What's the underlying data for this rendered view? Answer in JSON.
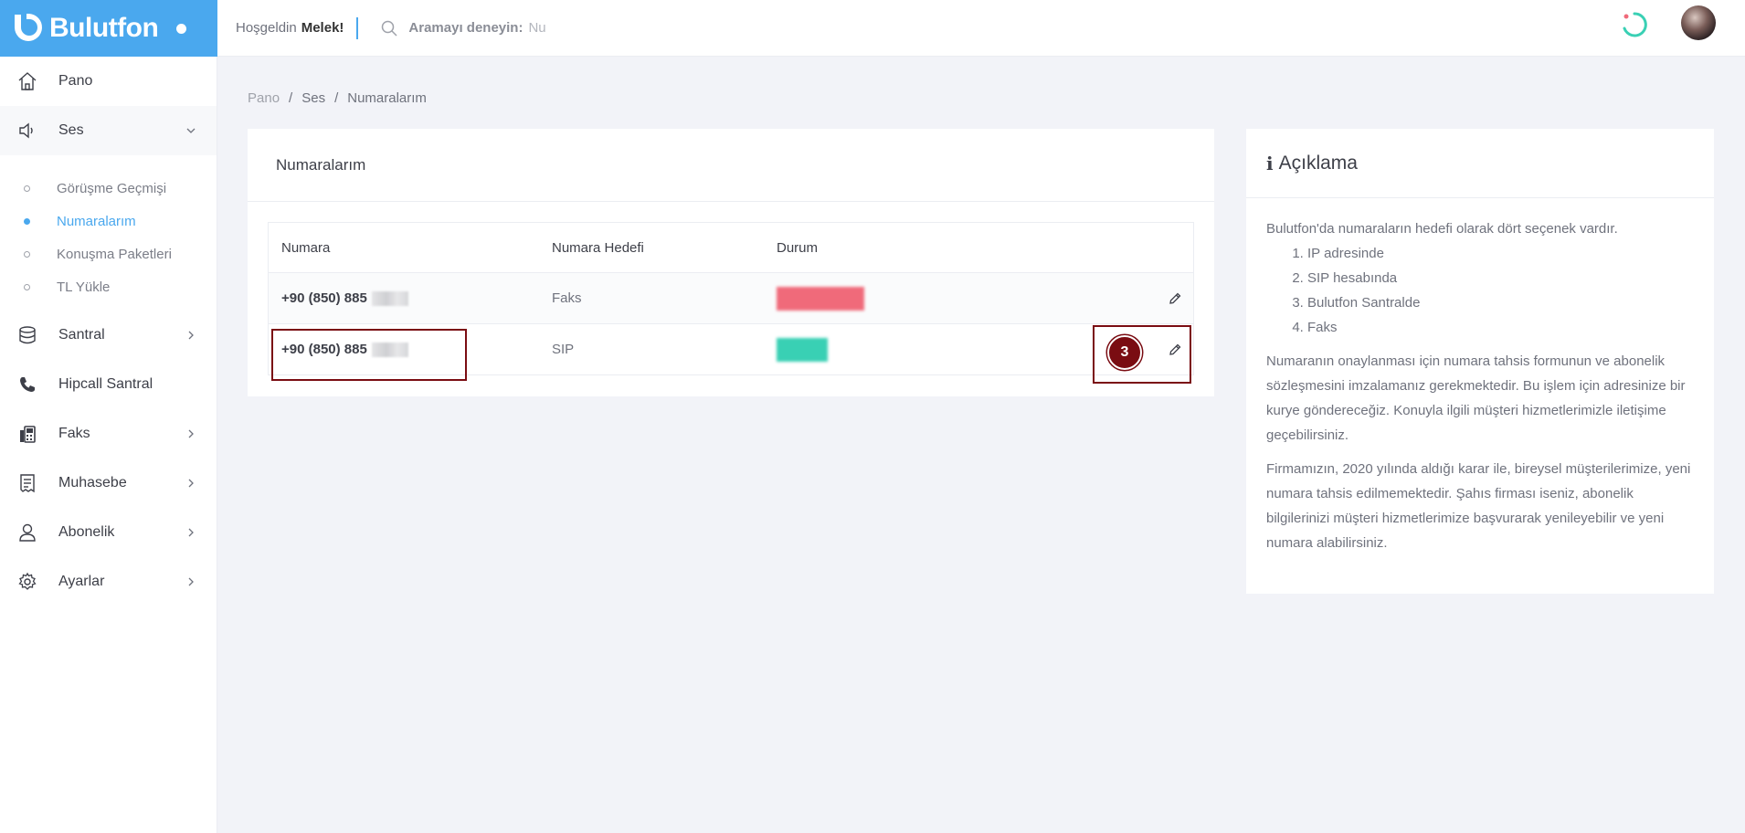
{
  "brand": {
    "name": "Bulutfon"
  },
  "header": {
    "welcome_prefix": "Hoşgeldin",
    "user_name": "Melek!",
    "search_label": "Aramayı deneyin:",
    "search_value": "Nu"
  },
  "sidebar": {
    "items": [
      {
        "label": "Pano",
        "icon": "home-icon"
      },
      {
        "label": "Ses",
        "icon": "speaker-icon"
      },
      {
        "label": "Santral",
        "icon": "database-icon"
      },
      {
        "label": "Hipcall Santral",
        "icon": "phone-icon"
      },
      {
        "label": "Faks",
        "icon": "fax-icon"
      },
      {
        "label": "Muhasebe",
        "icon": "receipt-icon"
      },
      {
        "label": "Abonelik",
        "icon": "user-icon"
      },
      {
        "label": "Ayarlar",
        "icon": "gear-icon"
      }
    ],
    "submenu": [
      {
        "label": "Görüşme Geçmişi"
      },
      {
        "label": "Numaralarım"
      },
      {
        "label": "Konuşma Paketleri"
      },
      {
        "label": "TL Yükle"
      }
    ]
  },
  "breadcrumb": [
    "Pano",
    "Ses",
    "Numaralarım"
  ],
  "numbers_card": {
    "title": "Numaralarım",
    "columns": [
      "Numara",
      "Numara Hedefi",
      "Durum"
    ],
    "rows": [
      {
        "number": "+90 (850) 885",
        "target": "Faks",
        "status_color": "#f06a7a"
      },
      {
        "number": "+90 (850) 885",
        "target": "SIP",
        "status_color": "#39d0b4"
      }
    ]
  },
  "annotation": {
    "marker_label": "3"
  },
  "info_card": {
    "title": "Açıklama",
    "intro": "Bulutfon'da numaraların hedefi olarak dört seçenek vardır.",
    "options": [
      "IP adresinde",
      "SIP hesabında",
      "Bulutfon Santralde",
      "Faks"
    ],
    "paragraph1": "Numaranın onaylanması için numara tahsis formunun ve abonelik sözleşmesini imzalamanız gerekmektedir. Bu işlem için adresinize bir kurye göndereceğiz. Konuyla ilgili müşteri hizmetlerimizle iletişime geçebilirsiniz.",
    "paragraph2": "Firmamızın, 2020 yılında aldığı karar ile, bireysel müşterilerimize, yeni numara tahsis edilmemektedir. Şahıs firması iseniz, abonelik bilgilerinizi müşteri hizmetlerimize başvurarak yenileyebilir ve yeni numara alabilirsiniz."
  },
  "colors": {
    "brand_blue": "#4aa8ee",
    "highlight": "#7a0c12"
  }
}
